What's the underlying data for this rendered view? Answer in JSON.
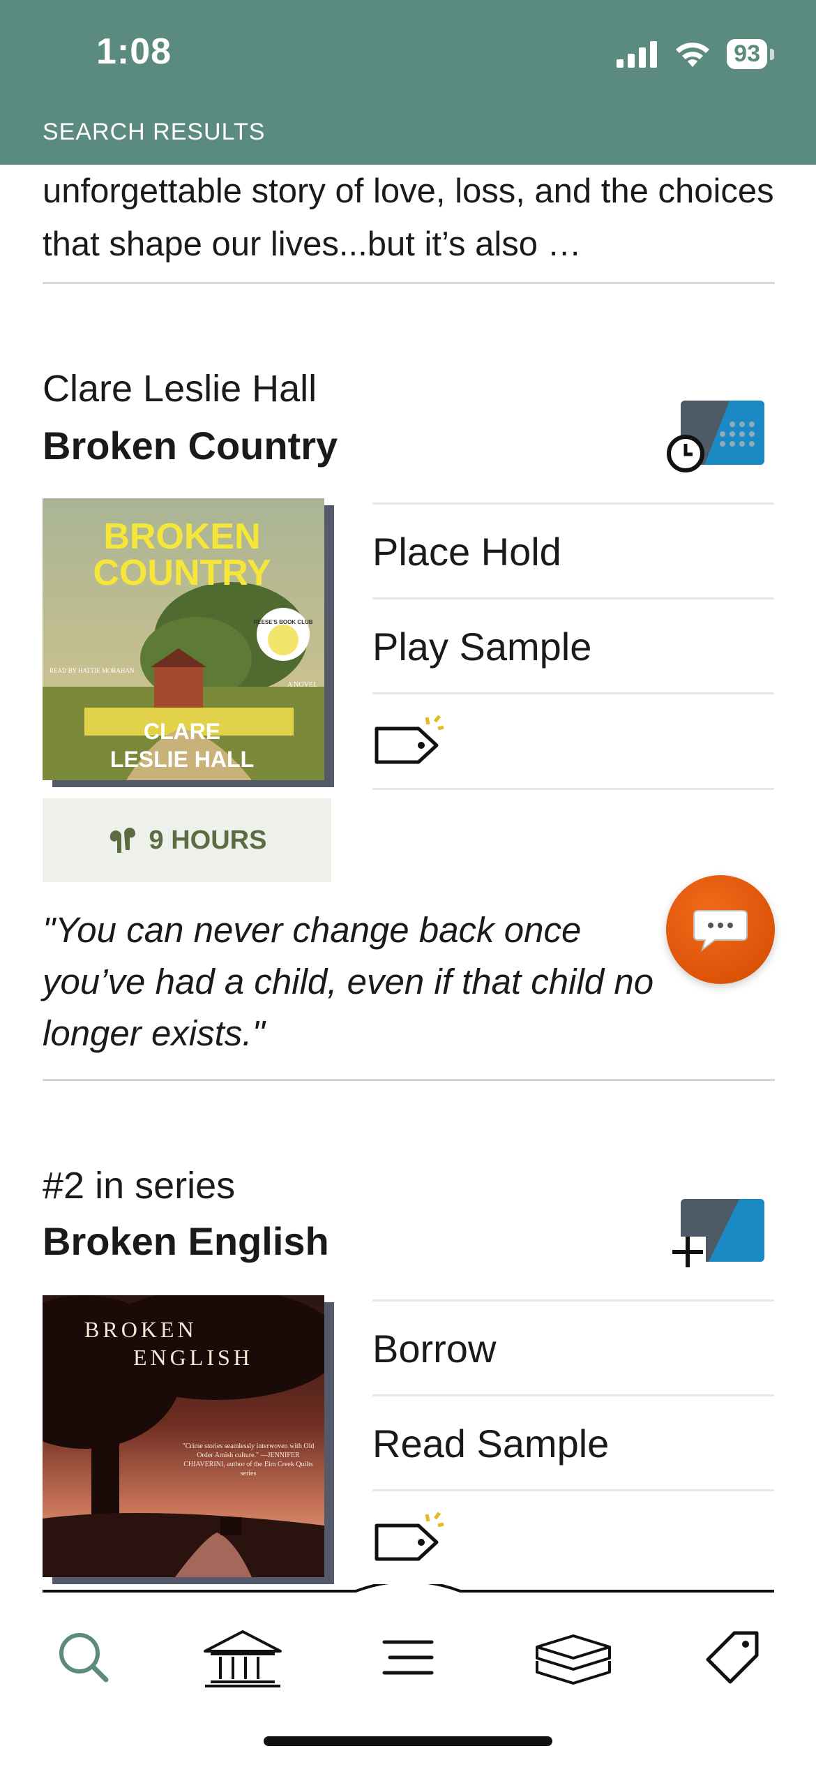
{
  "status_bar": {
    "time": "1:08",
    "battery": "93"
  },
  "header": {
    "title": "SEARCH RESULTS"
  },
  "prev_description": "unforgettable story of love, loss, and the choices that shape our lives...but it’s also …",
  "books": [
    {
      "author": "Clare Leslie Hall",
      "title": "Broken Country",
      "cover": {
        "title_line1": "BROKEN",
        "title_line2": "COUNTRY",
        "author_line1": "CLARE",
        "author_line2": "LESLIE HALL",
        "badge": "REESE'S BOOK CLUB",
        "read_by": "READ BY HATTIE MORAHAN",
        "subtitle": "A NOVEL"
      },
      "duration": "9 HOURS",
      "actions": [
        "Place Hold",
        "Play Sample"
      ],
      "quote": "\"You can never change back once you’ve had a child, even if that child no longer exists.\""
    },
    {
      "series": "#2 in series",
      "title": "Broken English",
      "cover": {
        "title_line1": "BROKEN",
        "title_line2": "ENGLISH",
        "blurb": "\"Crime stories seamlessly interwoven with Old Order Amish culture.\" —JENNIFER CHIAVERINI, author of the Elm Creek Quilts series"
      },
      "actions": [
        "Borrow",
        "Read Sample"
      ]
    }
  ],
  "tabbar": {
    "icons": [
      "search-icon",
      "library-icon",
      "menu-icon",
      "shelf-icon",
      "tag-icon"
    ]
  },
  "colors": {
    "header": "#5b8a7e",
    "accent_orange": "#e25a0c",
    "ebook_blue": "#1b8ac4",
    "badge_gray": "#4e5a66"
  }
}
